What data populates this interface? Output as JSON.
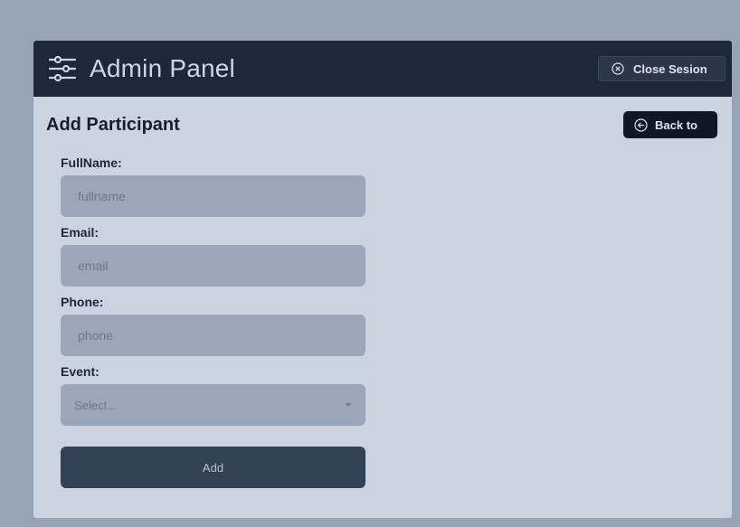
{
  "header": {
    "title": "Admin Panel",
    "menu_icon": "sliders-icon",
    "close_label": "Close Sesion",
    "close_icon": "circle-x-icon"
  },
  "page": {
    "title": "Add Participant",
    "back_label": "Back to",
    "back_icon": "circle-arrow-left-icon"
  },
  "form": {
    "fullname": {
      "label": "FullName:",
      "placeholder": "fullname"
    },
    "email": {
      "label": "Email:",
      "placeholder": "email"
    },
    "phone": {
      "label": "Phone:",
      "placeholder": "phone"
    },
    "event": {
      "label": "Event:",
      "selected": "Select..."
    },
    "submit_label": "Add"
  },
  "colors": {
    "background": "#97a3b6",
    "panel": "#cbd3e1",
    "header": "#1d283a",
    "field": "#9ba7b9",
    "button": "#334155"
  }
}
